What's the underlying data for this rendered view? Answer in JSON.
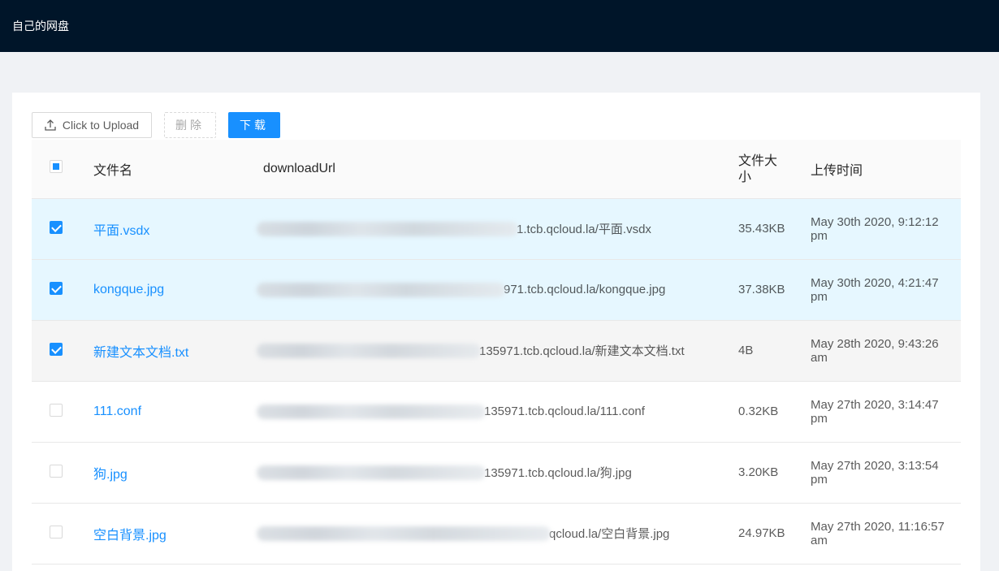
{
  "app": {
    "title": "自己的网盘"
  },
  "toolbar": {
    "upload_label": "Click to Upload",
    "delete_label": "删除",
    "download_label": "下载"
  },
  "table": {
    "headers": {
      "name": "文件名",
      "url": "downloadUrl",
      "size": "文件大小",
      "time": "上传时间"
    },
    "rows": [
      {
        "name": "平面.vsdx",
        "url_visible": "1.tcb.qcloud.la/平面.vsdx",
        "size": "35.43KB",
        "time": "May 30th 2020, 9:12:12 pm",
        "checked": true
      },
      {
        "name": "kongque.jpg",
        "url_visible": "971.tcb.qcloud.la/kongque.jpg",
        "size": "37.38KB",
        "time": "May 30th 2020, 4:21:47 pm",
        "checked": true
      },
      {
        "name": "新建文本文档.txt",
        "url_visible": "135971.tcb.qcloud.la/新建文本文档.txt",
        "size": "4B",
        "time": "May 28th 2020, 9:43:26 am",
        "checked": true
      },
      {
        "name": "111.conf",
        "url_visible": "135971.tcb.qcloud.la/111.conf",
        "size": "0.32KB",
        "time": "May 27th 2020, 3:14:47 pm",
        "checked": false
      },
      {
        "name": "狗.jpg",
        "url_visible": "135971.tcb.qcloud.la/狗.jpg",
        "size": "3.20KB",
        "time": "May 27th 2020, 3:13:54 pm",
        "checked": false
      },
      {
        "name": "空白背景.jpg",
        "url_visible": "qcloud.la/空白背景.jpg",
        "size": "24.97KB",
        "time": "May 27th 2020, 11:16:57 am",
        "checked": false
      }
    ]
  }
}
